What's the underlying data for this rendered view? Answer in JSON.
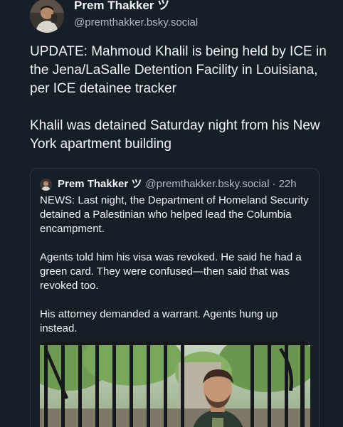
{
  "post": {
    "author": {
      "display_name": "Prem Thakker ツ",
      "handle": "@premthakker.bsky.social"
    },
    "paragraphs": [
      "UPDATE: Mahmoud Khalil is being held by ICE in the Jena/LaSalle Detention Facility in Louisiana, per ICE detainee tracker",
      "Khalil was detained Saturday night from his New York apartment building"
    ]
  },
  "quote": {
    "author": {
      "display_name": "Prem Thakker ツ",
      "handle": "@premthakker.bsky.social",
      "separator": "·",
      "time": "22h"
    },
    "paragraphs": [
      "NEWS: Last night, the Department of Homeland Security detained a Palestinian who helped lead the Columbia encampment.",
      "Agents told him his visa was revoked. He said he had a green card. They were confused—then said that was revoked too.",
      "His attorney demanded a warrant. Agents hung up instead."
    ]
  },
  "colors": {
    "background": "#161e27",
    "text": "#f1f3f5",
    "muted": "#aebbc9",
    "border": "#2e3a48"
  }
}
